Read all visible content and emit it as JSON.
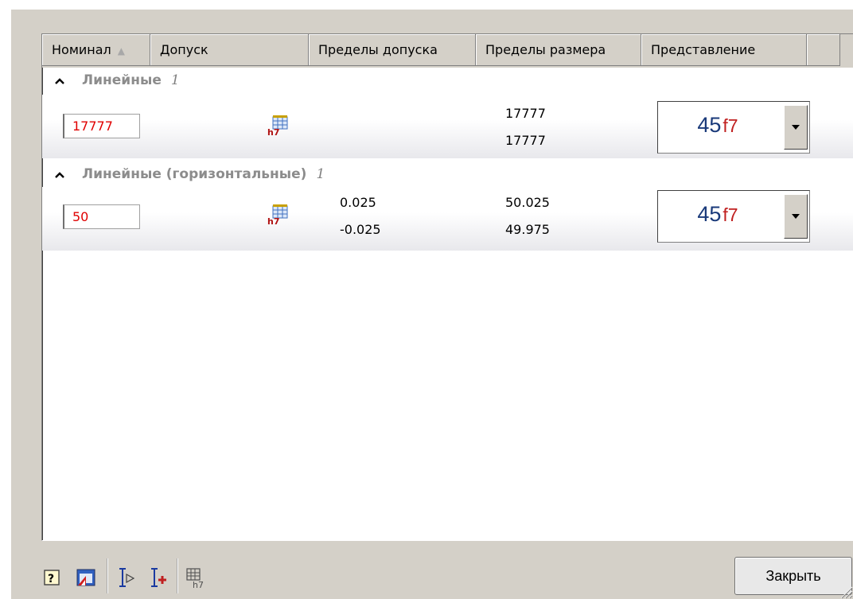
{
  "columns": [
    {
      "label": "Номинал"
    },
    {
      "label": "Допуск"
    },
    {
      "label": "Пределы допуска"
    },
    {
      "label": "Пределы размера"
    },
    {
      "label": "Представление"
    }
  ],
  "groups": [
    {
      "title": "Линейные",
      "count": "1",
      "row": {
        "nominal": "17777",
        "tolerance_icon": "h7-tolerance-icon",
        "tol_upper": "",
        "tol_lower": "",
        "size_upper": "17777",
        "size_lower": "17777",
        "repr_nominal": "45",
        "repr_tolerance": "f7"
      }
    },
    {
      "title": "Линейные (горизонтальные)",
      "count": "1",
      "row": {
        "nominal": "50",
        "tolerance_icon": "h7-tolerance-icon",
        "tol_upper": "0.025",
        "tol_lower": "-0.025",
        "size_upper": "50.025",
        "size_lower": "49.975",
        "repr_nominal": "45",
        "repr_tolerance": "f7"
      }
    }
  ],
  "toolbar": {
    "icons": [
      "help-icon",
      "settings-icon",
      "select-dimension-icon",
      "add-dimension-icon",
      "tolerance-table-icon"
    ]
  },
  "close_label": "Закрыть",
  "colors": {
    "nominal_text": "#e00000",
    "repr_nominal": "#1a3a7a",
    "repr_tolerance": "#c02020",
    "dialog_bg": "#d4d0c8"
  }
}
